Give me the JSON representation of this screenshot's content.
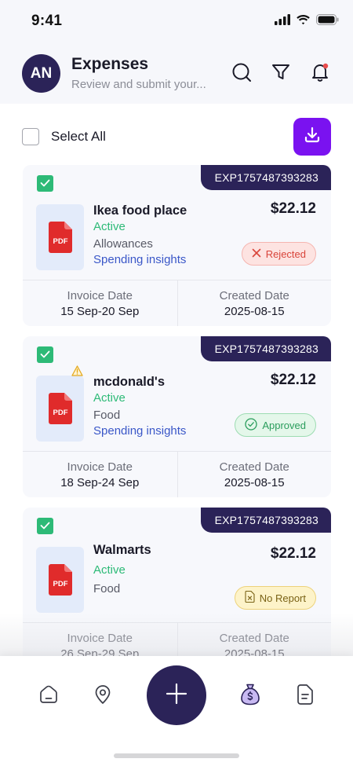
{
  "status_bar": {
    "time": "9:41"
  },
  "header": {
    "avatar_initials": "AN",
    "title": "Expenses",
    "subtitle": "Review and submit your..."
  },
  "toolbar": {
    "select_all_label": "Select All"
  },
  "expenses": [
    {
      "id": "EXP1757487393283",
      "merchant": "Ikea food place",
      "status": "Active",
      "category": "Allowances",
      "insights_link": "Spending insights",
      "amount": "$22.12",
      "report_status": "Rejected",
      "selected": true,
      "warning": false,
      "invoice_date_label": "Invoice Date",
      "invoice_date": "15 Sep-20 Sep",
      "created_date_label": "Created Date",
      "created_date": "2025-08-15"
    },
    {
      "id": "EXP1757487393283",
      "merchant": "mcdonald's",
      "status": "Active",
      "category": "Food",
      "insights_link": "Spending insights",
      "amount": "$22.12",
      "report_status": "Approved",
      "selected": true,
      "warning": true,
      "invoice_date_label": "Invoice Date",
      "invoice_date": "18 Sep-24 Sep",
      "created_date_label": "Created Date",
      "created_date": "2025-08-15"
    },
    {
      "id": "EXP1757487393283",
      "merchant": "Walmarts",
      "status": "Active",
      "category": "Food",
      "insights_link": "",
      "amount": "$22.12",
      "report_status": "No Report",
      "selected": true,
      "warning": false,
      "invoice_date_label": "Invoice Date",
      "invoice_date": "26 Sep-29 Sep",
      "created_date_label": "Created Date",
      "created_date": "2025-08-15"
    }
  ],
  "pdf_label": "PDF",
  "colors": {
    "primary": "#2b2358",
    "accent": "#7a12f0",
    "active_green": "#2dba77",
    "link_blue": "#3a57c8",
    "rejected_red": "#d9443a",
    "pdf_red": "#e02b2b"
  },
  "icons": {
    "header": [
      "search-icon",
      "filter-icon",
      "bell-icon"
    ],
    "nav": [
      "home-icon",
      "location-icon",
      "add-icon",
      "money-bag-icon",
      "document-icon"
    ]
  }
}
